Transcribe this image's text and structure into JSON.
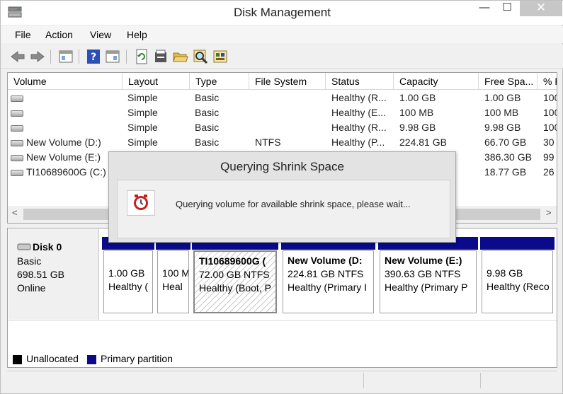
{
  "window": {
    "title": "Disk Management",
    "min": "—",
    "max": "☐",
    "close": "✕"
  },
  "menu": [
    "File",
    "Action",
    "View",
    "Help"
  ],
  "toolbar": [
    "back-icon",
    "forward-icon",
    "console-tree-icon",
    "help-icon",
    "properties-icon",
    "refresh-icon",
    "settings-icon",
    "open-folder-icon",
    "search-icon",
    "tools-icon"
  ],
  "columns": [
    "Volume",
    "Layout",
    "Type",
    "File System",
    "Status",
    "Capacity",
    "Free Spa...",
    "% F"
  ],
  "rows": [
    {
      "volume": "",
      "layout": "Simple",
      "type": "Basic",
      "fs": "",
      "status": "Healthy (R...",
      "capacity": "1.00 GB",
      "free": "1.00 GB",
      "pct": "100"
    },
    {
      "volume": "",
      "layout": "Simple",
      "type": "Basic",
      "fs": "",
      "status": "Healthy (E...",
      "capacity": "100 MB",
      "free": "100 MB",
      "pct": "100"
    },
    {
      "volume": "",
      "layout": "Simple",
      "type": "Basic",
      "fs": "",
      "status": "Healthy (R...",
      "capacity": "9.98 GB",
      "free": "9.98 GB",
      "pct": "100"
    },
    {
      "volume": "New Volume (D:)",
      "layout": "Simple",
      "type": "Basic",
      "fs": "NTFS",
      "status": "Healthy (P...",
      "capacity": "224.81 GB",
      "free": "66.70 GB",
      "pct": "30"
    },
    {
      "volume": "New Volume (E:)",
      "layout": "",
      "type": "",
      "fs": "",
      "status": "",
      "capacity": "",
      "free": "386.30 GB",
      "pct": "99"
    },
    {
      "volume": "TI10689600G (C:)",
      "layout": "",
      "type": "",
      "fs": "",
      "status": "",
      "capacity": "",
      "free": "18.77 GB",
      "pct": "26"
    }
  ],
  "scroll": {
    "left": "<",
    "right": ">"
  },
  "disk": {
    "name": "Disk 0",
    "type": "Basic",
    "size": "698.51 GB",
    "state": "Online"
  },
  "partitions": [
    {
      "name": "",
      "size": "1.00 GB",
      "status": "Healthy ("
    },
    {
      "name": "",
      "size": "100 M",
      "status": "Heal"
    },
    {
      "name": "TI10689600G (",
      "size": "72.00 GB NTFS",
      "status": "Healthy (Boot, P"
    },
    {
      "name": "New Volume  (D:",
      "size": "224.81 GB NTFS",
      "status": "Healthy (Primary I"
    },
    {
      "name": "New Volume  (E:)",
      "size": "390.63 GB NTFS",
      "status": "Healthy (Primary P"
    },
    {
      "name": "",
      "size": "9.98 GB",
      "status": "Healthy (Reco"
    }
  ],
  "legend": [
    {
      "label": "Unallocated",
      "color": "#000000"
    },
    {
      "label": "Primary partition",
      "color": "#0a0a8a"
    }
  ],
  "dialog": {
    "title": "Querying Shrink Space",
    "message": "Querying volume for available shrink space, please wait...",
    "icon": "clock-icon"
  }
}
